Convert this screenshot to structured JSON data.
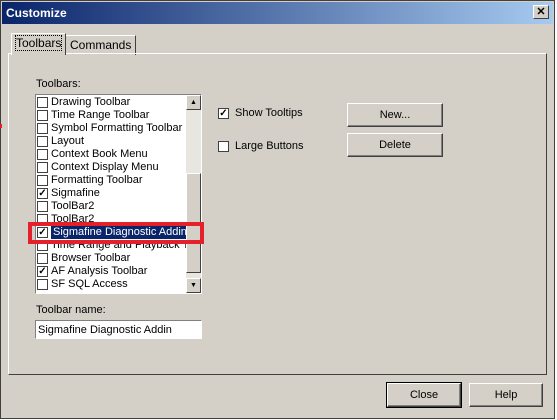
{
  "window": {
    "title": "Customize",
    "close_glyph": "✕"
  },
  "tabs": [
    {
      "label": "Toolbars",
      "active": true
    },
    {
      "label": "Commands",
      "active": false
    }
  ],
  "toolbars_label": "Toolbars:",
  "toolbar_list": [
    {
      "label": "Drawing Toolbar",
      "checked": false
    },
    {
      "label": "Time Range Toolbar",
      "checked": false
    },
    {
      "label": "Symbol Formatting Toolbar",
      "checked": false
    },
    {
      "label": "Layout",
      "checked": false
    },
    {
      "label": "Context Book Menu",
      "checked": false
    },
    {
      "label": "Context Display Menu",
      "checked": false
    },
    {
      "label": "Formatting Toolbar",
      "checked": false
    },
    {
      "label": "Sigmafine",
      "checked": true
    },
    {
      "label": "ToolBar2",
      "checked": false
    },
    {
      "label": "ToolBar2",
      "checked": false
    },
    {
      "label": "Sigmafine Diagnostic Addin",
      "checked": true,
      "selected": true
    },
    {
      "label": "Time Range and Playback T",
      "checked": false
    },
    {
      "label": "Browser Toolbar",
      "checked": false
    },
    {
      "label": "AF Analysis Toolbar",
      "checked": true
    },
    {
      "label": "SF SQL Access",
      "checked": false
    }
  ],
  "options": {
    "show_tooltips": {
      "label": "Show Tooltips",
      "checked": true
    },
    "large_buttons": {
      "label": "Large Buttons",
      "checked": false
    }
  },
  "buttons": {
    "new": "New...",
    "delete": "Delete",
    "close": "Close",
    "help": "Help"
  },
  "toolbar_name": {
    "label": "Toolbar name:",
    "value": "Sigmafine Diagnostic Addin"
  },
  "scrollbar": {
    "up_glyph": "▲",
    "down_glyph": "▼"
  },
  "colors": {
    "highlight_box": "#e4202a",
    "selection": "#0a246a",
    "title_start": "#0a246a"
  }
}
